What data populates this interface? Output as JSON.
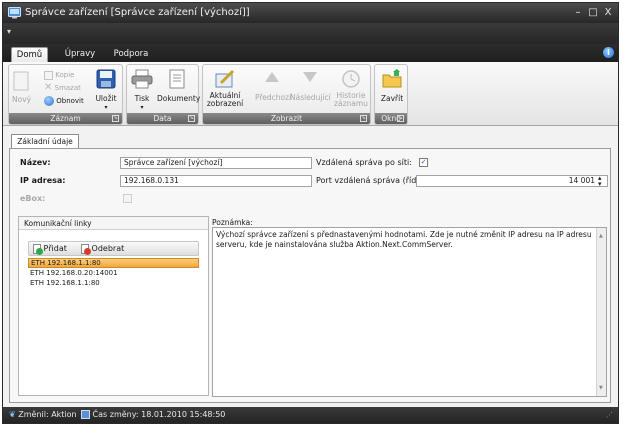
{
  "window": {
    "title": "Správce zařízení [Správce zařízení [výchozí]]",
    "controls": {
      "minimize": "–",
      "maximize": "□",
      "close": "X"
    }
  },
  "qat": {
    "menu": "▾"
  },
  "ribbon": {
    "tabs": [
      {
        "label": "Domů",
        "active": true
      },
      {
        "label": "Úpravy",
        "active": false
      },
      {
        "label": "Podpora",
        "active": false
      }
    ],
    "help_icon": "info-icon",
    "groups": {
      "zaznam": {
        "caption": "Záznam",
        "novy": "Nový",
        "kopie": "Kopie",
        "smazat": "Smazat",
        "obnovit": "Obnovit",
        "ulozit": "Uložit"
      },
      "data": {
        "caption": "Data",
        "tisk": "Tisk",
        "dokumenty": "Dokumenty"
      },
      "zobrazit": {
        "caption": "Zobrazit",
        "aktualni_zobrazeni": "Aktuální zobrazení",
        "predchozi": "Předchozí",
        "nasledujici": "Následující",
        "historie_zaznamu": "Historie záznamu"
      },
      "okno": {
        "caption": "Okno",
        "zavrit": "Zavřít"
      }
    }
  },
  "detail": {
    "tab_label": "Základní údaje",
    "fields": {
      "nazev_label": "Název:",
      "nazev_value": "Správce zařízení [výchozí]",
      "ip_label": "IP adresa:",
      "ip_value": "192.168.0.131",
      "ebox_label": "eBox:",
      "ebox_checked": false,
      "vzdalena_label": "Vzdálená správa po síti:",
      "vzdalena_checked": true,
      "port_label": "Port vzdálená správa (řídicí):",
      "port_value": "14 001"
    },
    "komunikacni_linky": {
      "title": "Komunikační linky",
      "add_label": "Přidat",
      "remove_label": "Odebrat",
      "items": [
        {
          "text": "ETH 192.168.1.1:80",
          "selected": true
        },
        {
          "text": "ETH 192.168.0.20:14001",
          "selected": false
        },
        {
          "text": "ETH 192.168.1.1:80",
          "selected": false
        }
      ]
    },
    "poznamka": {
      "label": "Poznámka:",
      "text": "Výchozí správce zařízení s přednastavenými hodnotami. Zde je nutné změnit IP adresu na IP adresu serveru, kde je nainstalována služba Aktion.Next.CommServer."
    }
  },
  "status": {
    "changed_by": "Změnil: Aktion",
    "changed_at": "Čas změny: 18.01.2010 15:48:50"
  }
}
